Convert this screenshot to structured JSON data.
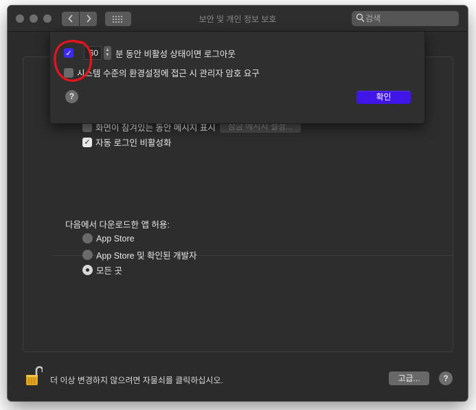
{
  "window": {
    "title": "보안 및 개인 정보 보호",
    "search_placeholder": "검색"
  },
  "icons": {
    "back": "chevron-left-icon",
    "forward": "chevron-right-icon",
    "grid": "grid-icon",
    "search": "magnifier-icon",
    "lock": "open-lock-icon",
    "help": "question-mark-icon"
  },
  "sheet": {
    "logout_checked": true,
    "logout_minutes": "60",
    "logout_label": "분 동안 비활성 상태이면 로그아웃",
    "admin_checked": false,
    "admin_label": "시스템 수준의 환경설정에 접근 시 관리자 암호 요구",
    "help_label": "?",
    "ok_label": "확인"
  },
  "general": {
    "lock_message_checked": false,
    "lock_message_label": "화면이 잠겨있는 동안 메시지 표시",
    "lock_message_button": "잠금 메시지 설정...",
    "auto_login_checked": true,
    "auto_login_label": "자동 로그인 비활성화"
  },
  "downloads": {
    "heading": "다음에서 다운로드한 앱 허용:",
    "options": [
      {
        "label": "App Store",
        "selected": false
      },
      {
        "label": "App Store 및 확인된 개발자",
        "selected": false
      },
      {
        "label": "모든 곳",
        "selected": true
      }
    ]
  },
  "footer": {
    "lock_text": "더 이상 변경하지 않으려면 자물쇠를 클릭하십시오.",
    "advanced_label": "고급...",
    "help_label": "?"
  },
  "colors": {
    "accent": "#4016e8",
    "annotation": "#e8141c",
    "window_bg": "#2b2b2b"
  }
}
